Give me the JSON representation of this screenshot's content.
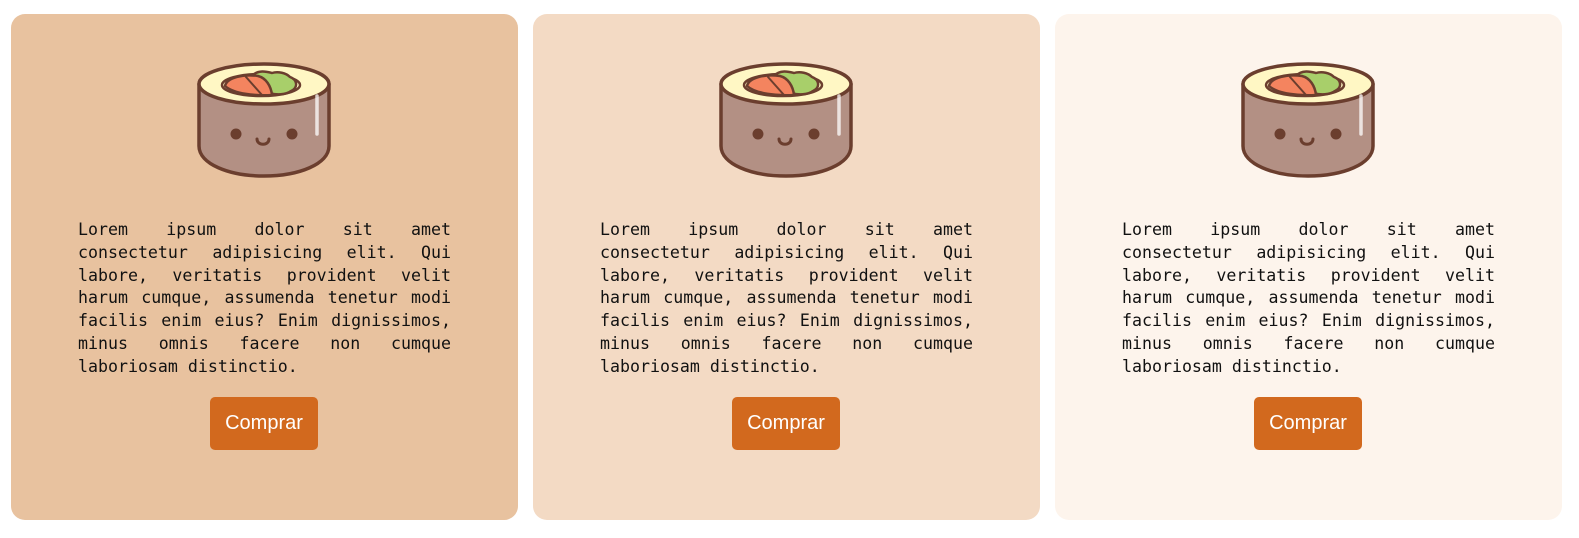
{
  "colors": {
    "button": "#d2691e",
    "sushi_outline": "#6b3e2e",
    "sushi_body": "#b39084",
    "sushi_rice": "#fff7c4",
    "salmon": "#f4845f",
    "avocado": "#a8cf6a"
  },
  "cards": [
    {
      "background": "#e8c29f",
      "icon": "sushi-roll-icon",
      "text": "Lorem ipsum dolor sit amet consectetur adipisicing elit. Qui labore, veritatis provident velit harum cumque, assumenda tenetur modi facilis enim eius? Enim dignissimos, minus omnis facere non cumque laboriosam distinctio.",
      "button_label": "Comprar"
    },
    {
      "background": "#f3dac4",
      "icon": "sushi-roll-icon",
      "text": "Lorem ipsum dolor sit amet consectetur adipisicing elit. Qui labore, veritatis provident velit harum cumque, assumenda tenetur modi facilis enim eius? Enim dignissimos, minus omnis facere non cumque laboriosam distinctio.",
      "button_label": "Comprar"
    },
    {
      "background": "#fdf4ec",
      "icon": "sushi-roll-icon",
      "text": "Lorem ipsum dolor sit amet consectetur adipisicing elit. Qui labore, veritatis provident velit harum cumque, assumenda tenetur modi facilis enim eius? Enim dignissimos, minus omnis facere non cumque laboriosam distinctio.",
      "button_label": "Comprar"
    }
  ]
}
